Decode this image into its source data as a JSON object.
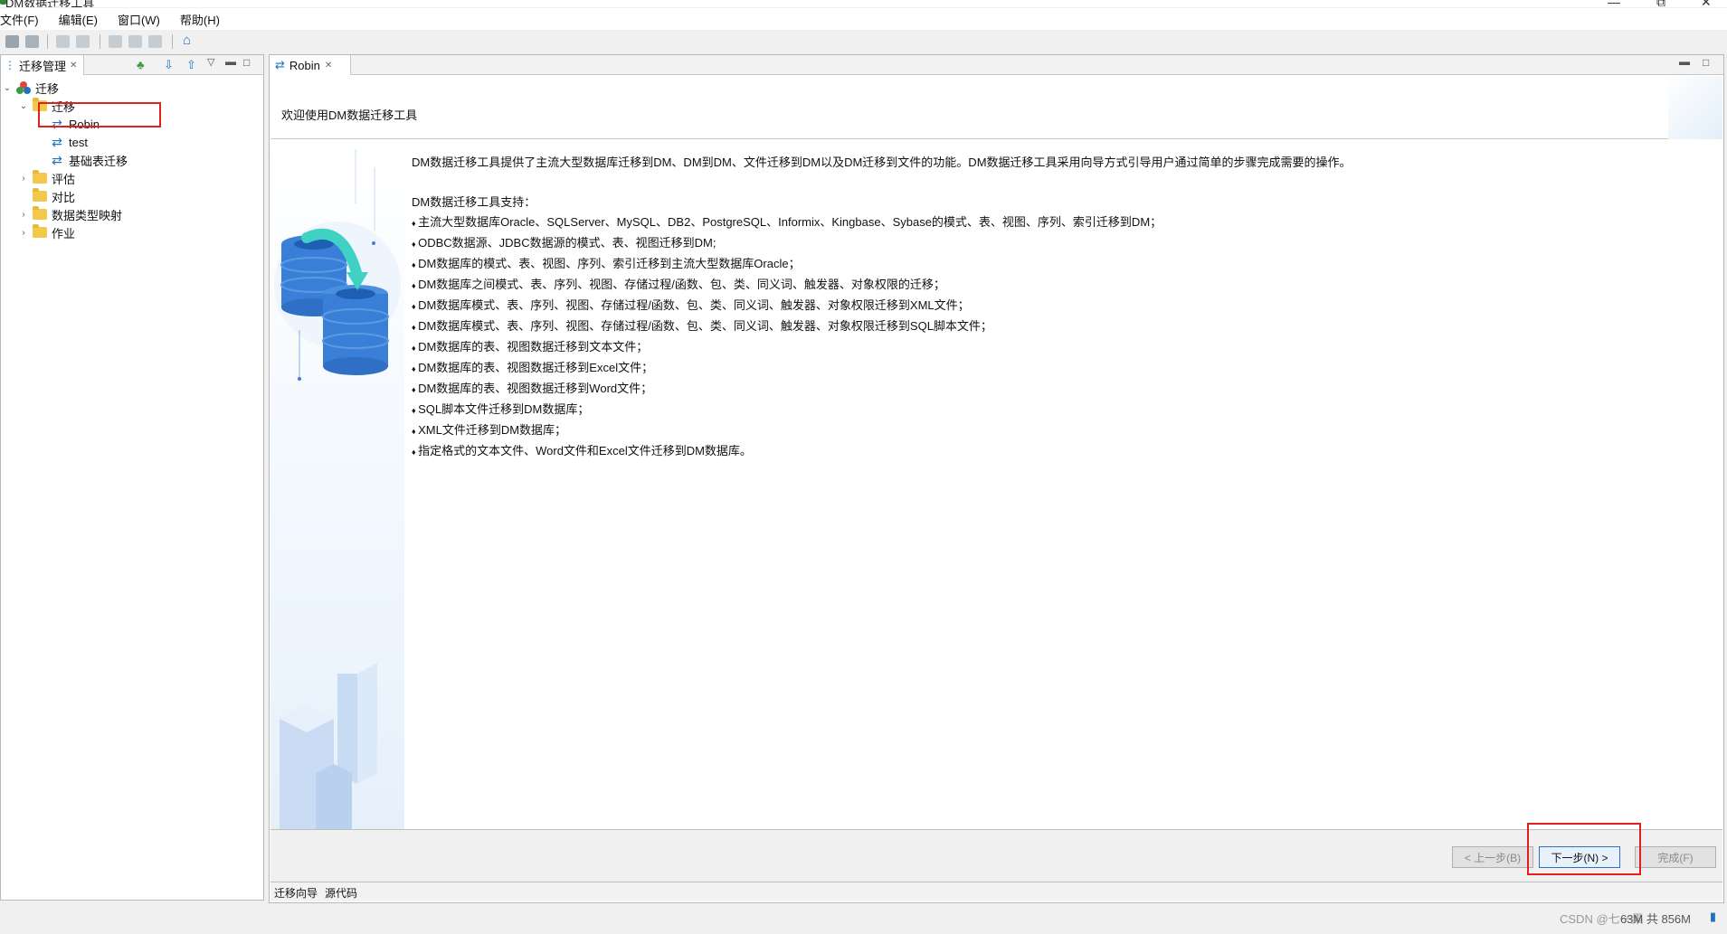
{
  "window": {
    "title": "DM数据迁移工具"
  },
  "menu": [
    "文件(F)",
    "编辑(E)",
    "窗口(W)",
    "帮助(H)"
  ],
  "left_panel": {
    "tab_label": "迁移管理",
    "tree": {
      "root": "迁移",
      "migration_folder": "迁移",
      "items": [
        "Robin",
        "test",
        "基础表迁移"
      ],
      "folders": [
        "评估",
        "对比",
        "数据类型映射",
        "作业"
      ]
    }
  },
  "editor": {
    "tab_label": "Robin",
    "welcome": "欢迎使用DM数据迁移工具",
    "intro": "DM数据迁移工具提供了主流大型数据库迁移到DM、DM到DM、文件迁移到DM以及DM迁移到文件的功能。DM数据迁移工具采用向导方式引导用户通过简单的步骤完成需要的操作。",
    "support_title": "DM数据迁移工具支持：",
    "features": [
      "主流大型数据库Oracle、SQLServer、MySQL、DB2、PostgreSQL、Informix、Kingbase、Sybase的模式、表、视图、序列、索引迁移到DM；",
      "ODBC数据源、JDBC数据源的模式、表、视图迁移到DM;",
      "DM数据库的模式、表、视图、序列、索引迁移到主流大型数据库Oracle；",
      "DM数据库之间模式、表、序列、视图、存储过程/函数、包、类、同义词、触发器、对象权限的迁移；",
      "DM数据库模式、表、序列、视图、存储过程/函数、包、类、同义词、触发器、对象权限迁移到XML文件；",
      "DM数据库模式、表、序列、视图、存储过程/函数、包、类、同义词、触发器、对象权限迁移到SQL脚本文件；",
      "DM数据库的表、视图数据迁移到文本文件；",
      "DM数据库的表、视图数据迁移到Excel文件；",
      "DM数据库的表、视图数据迁移到Word文件；",
      "SQL脚本文件迁移到DM数据库；",
      "XML文件迁移到DM数据库；",
      "指定格式的文本文件、Word文件和Excel文件迁移到DM数据库。"
    ],
    "buttons": {
      "back": "< 上一步(B)",
      "next": "下一步(N) >",
      "finish": "完成(F)"
    },
    "bottom_tabs": [
      "迁移向导",
      "源代码"
    ]
  },
  "status": {
    "memory": "63M 共 856M",
    "watermark": "CSDN @七一果"
  },
  "colors": {
    "accent": "#1e73be",
    "highlight": "#e0201d"
  }
}
